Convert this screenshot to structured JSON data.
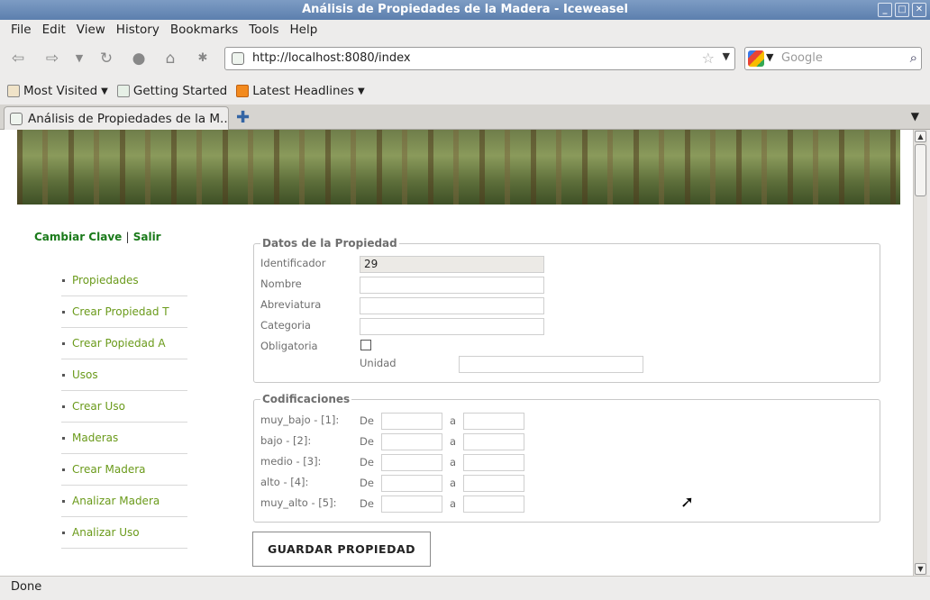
{
  "window": {
    "title": "Análisis de Propiedades de la Madera - Iceweasel"
  },
  "menu": [
    "File",
    "Edit",
    "View",
    "History",
    "Bookmarks",
    "Tools",
    "Help"
  ],
  "nav": {
    "url": "http://localhost:8080/index",
    "search_placeholder": "Google"
  },
  "bookmarks": [
    "Most Visited",
    "Getting Started",
    "Latest Headlines"
  ],
  "tab": {
    "title": "Análisis de Propiedades de la M..."
  },
  "page": {
    "top_links": {
      "change": "Cambiar Clave",
      "sep": "|",
      "logout": "Salir"
    },
    "sidebar": [
      "Propiedades",
      "Crear Propiedad T",
      "Crear Popiedad A",
      "Usos",
      "Crear Uso",
      "Maderas",
      "Crear Madera",
      "Analizar Madera",
      "Analizar Uso"
    ],
    "datos": {
      "legend": "Datos de la Propiedad",
      "id_label": "Identificador",
      "id_value": "29",
      "nombre_label": "Nombre",
      "abrev_label": "Abreviatura",
      "categoria_label": "Categoria",
      "oblig_label": "Obligatoria",
      "unidad_label": "Unidad"
    },
    "codif": {
      "legend": "Codificaciones",
      "de": "De",
      "a": "a",
      "rows": [
        "muy_bajo - [1]:",
        "bajo - [2]:",
        "medio - [3]:",
        "alto - [4]:",
        "muy_alto - [5]:"
      ]
    },
    "save_button": "GUARDAR PROPIEDAD"
  },
  "status": "Done"
}
